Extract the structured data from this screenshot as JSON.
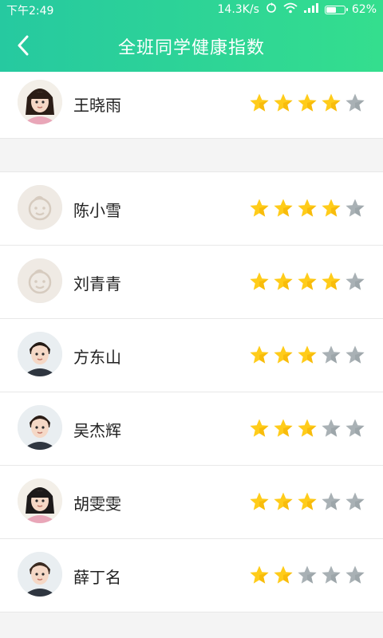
{
  "status": {
    "time": "下午2:49",
    "speed": "14.3K/s",
    "battery": "62%",
    "battery_level": 0.62
  },
  "header": {
    "title": "全班同学健康指数",
    "back_icon": "chevron-left-icon"
  },
  "colors": {
    "header_start": "#26c9a0",
    "header_end": "#34de8e",
    "star_on": "#ffcc1a",
    "star_off": "#a9b1b5"
  },
  "students": [
    {
      "name": "王晓雨",
      "rating": 4,
      "max": 5,
      "avatar": "photo-girl"
    },
    {
      "name": "陈小雪",
      "rating": 4,
      "max": 5,
      "avatar": "placeholder-baby-face"
    },
    {
      "name": "刘青青",
      "rating": 4,
      "max": 5,
      "avatar": "placeholder-baby-face"
    },
    {
      "name": "方东山",
      "rating": 3,
      "max": 5,
      "avatar": "photo-boy"
    },
    {
      "name": "吴杰辉",
      "rating": 3,
      "max": 5,
      "avatar": "photo-boy"
    },
    {
      "name": "胡雯雯",
      "rating": 3,
      "max": 5,
      "avatar": "photo-girl"
    },
    {
      "name": "薛丁名",
      "rating": 2,
      "max": 5,
      "avatar": "photo-boy"
    }
  ]
}
